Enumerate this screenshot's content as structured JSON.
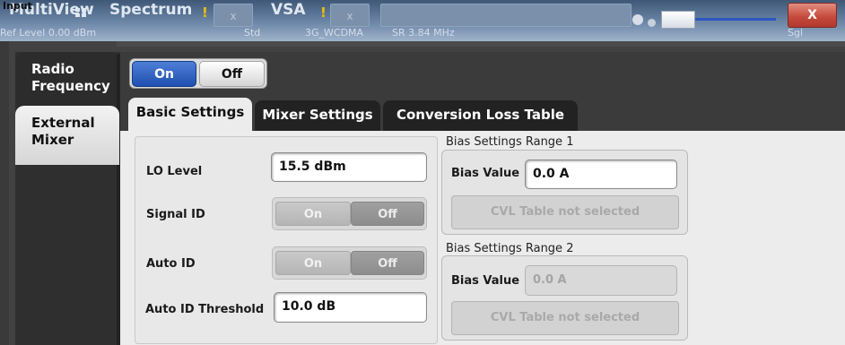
{
  "header": {
    "multiview_label": "MultiView",
    "multiview_icon": "grid-icon",
    "tab_spectrum": "Spectrum",
    "tab_vsa": "VSA",
    "input_label": "Input",
    "ref_level": "Ref Level 0.00 dBm",
    "std_label": "Std",
    "standard": "3G_WCDMA",
    "sample_rate": "SR 3.84 MHz",
    "sgl_label": "Sgl",
    "close_label": "X",
    "colors": {
      "header_gradient_top": "#3f5878",
      "close": "#c4483a"
    }
  },
  "side_tabs": [
    {
      "label_line1": "Radio",
      "label_line2": "Frequency",
      "selected": false
    },
    {
      "label_line1": "External",
      "label_line2": "Mixer",
      "selected": true
    }
  ],
  "state_toggle": {
    "on_label": "On",
    "off_label": "Off",
    "value": "On",
    "active_color": "#1f4fb0"
  },
  "sub_tabs": [
    {
      "label": "Basic Settings",
      "selected": true
    },
    {
      "label": "Mixer Settings",
      "selected": false
    },
    {
      "label": "Conversion Loss Table",
      "selected": false
    }
  ],
  "basic": {
    "lo_level": {
      "label": "LO Level",
      "value": "15.5 dBm"
    },
    "signal_id": {
      "label": "Signal ID",
      "on": "On",
      "off": "Off",
      "value": "Off"
    },
    "auto_id": {
      "label": "Auto ID",
      "on": "On",
      "off": "Off",
      "value": "Off"
    },
    "auto_id_threshold": {
      "label": "Auto ID Threshold",
      "value": "10.0 dB"
    }
  },
  "bias1": {
    "title": "Bias Settings Range 1",
    "bias_label": "Bias Value",
    "bias_value": "0.0 A",
    "cvl_button": "CVL Table not selected"
  },
  "bias2": {
    "title": "Bias Settings Range 2",
    "bias_label": "Bias Value",
    "bias_value": "0.0 A",
    "cvl_button": "CVL Table not selected"
  }
}
